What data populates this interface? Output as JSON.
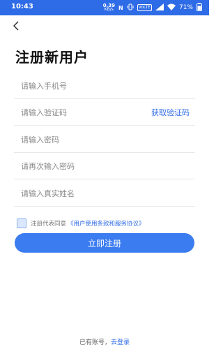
{
  "status_bar": {
    "time": "10:43",
    "speed_value": "0.39",
    "speed_unit": "KB/s",
    "nfc": "N",
    "sim_label": "VoLTE",
    "battery": "71%"
  },
  "header": {
    "title": "注册新用户"
  },
  "form": {
    "phone_placeholder": "请输入手机号",
    "code_placeholder": "请输入验证码",
    "get_code_label": "获取验证码",
    "password_placeholder": "请输入密码",
    "confirm_password_placeholder": "请再次输入密码",
    "realname_placeholder": "请输入真实姓名"
  },
  "agreement": {
    "text": "注册代表同意",
    "link": "《用户使用条款和服务协议》"
  },
  "submit_label": "立即注册",
  "footer": {
    "text": "已有账号，",
    "login_link": "去登录"
  },
  "colors": {
    "accent": "#3b7cf0",
    "status_bar": "#2e6be6"
  }
}
